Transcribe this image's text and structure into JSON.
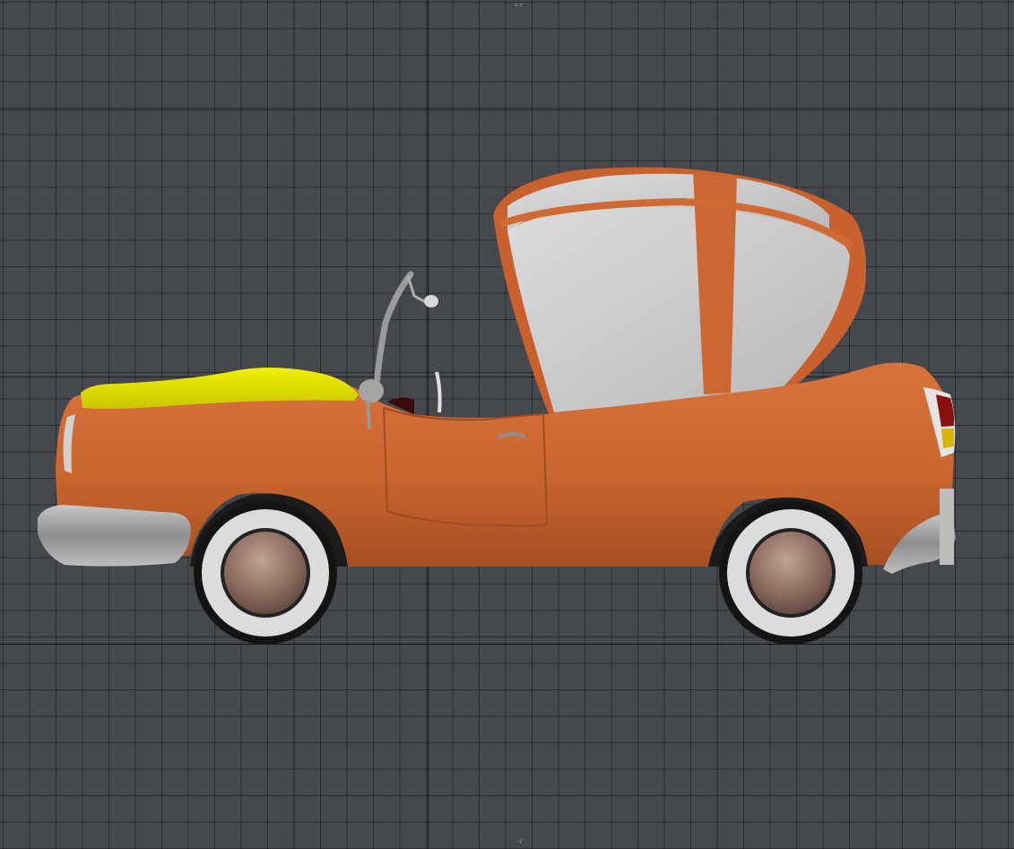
{
  "viewport": {
    "axis_label_top": "+Y",
    "axis_label_bottom": "-Y"
  },
  "colors": {
    "background": "#45484c",
    "car_body": "#cc6633",
    "hood": "#e2e000",
    "roof": "#c9c9c9",
    "chrome": "#a8a8a8",
    "tire": "#141414",
    "whitewall": "#d8d8d8",
    "hubcap": "#8a6a5e"
  }
}
